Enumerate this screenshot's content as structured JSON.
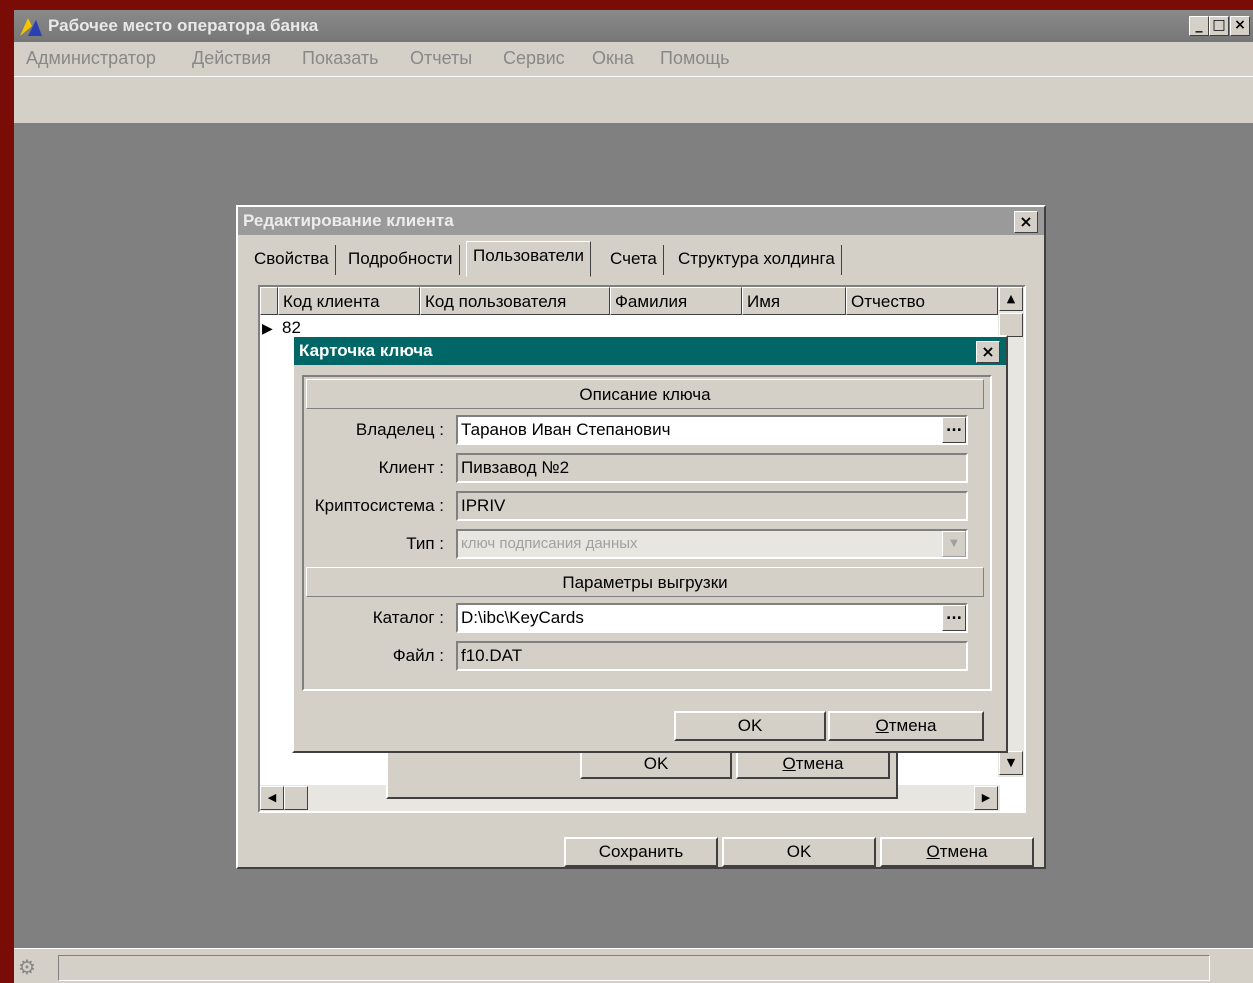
{
  "app": {
    "title": "Рабочее место оператора банка",
    "window_buttons": [
      "_",
      "□",
      "×"
    ],
    "menu": [
      "Администратор",
      "Действия",
      "Показать",
      "Отчеты",
      "Сервис",
      "Окна",
      "Помощь"
    ]
  },
  "edit_dialog": {
    "title": "Редактирование клиента",
    "close": "×",
    "tabs": [
      "Свойства",
      "Подробности",
      "Пользователи",
      "Счета",
      "Структура холдинга"
    ],
    "active_tab": "Пользователи",
    "grid": {
      "columns": [
        "Код клиента",
        "Код пользователя",
        "Фамилия",
        "Имя",
        "Отчество"
      ],
      "first_row_visible": "82"
    },
    "buttons": {
      "save": "Сохранить",
      "ok": "OK",
      "cancel_prefix": "О",
      "cancel_rest": "тмена"
    }
  },
  "middle_dialog": {
    "buttons": {
      "ok": "OK",
      "cancel_prefix": "О",
      "cancel_rest": "тмена"
    }
  },
  "key_card": {
    "title": "Карточка ключа",
    "close": "×",
    "section_description": "Описание ключа",
    "owner_label": "Владелец :",
    "owner_value": "Таранов Иван Степанович",
    "client_label": "Клиент :",
    "client_value": "Пивзавод №2",
    "crypto_label": "Криптосистема :",
    "crypto_value": "IPRIV",
    "type_label": "Тип :",
    "type_value": "ключ подписания данных",
    "section_export": "Параметры выгрузки",
    "catalog_label": "Каталог :",
    "catalog_value": "D:\\ibc\\KeyCards",
    "file_label": "Файл :",
    "file_value": "f10.DAT",
    "buttons": {
      "ok": "OK",
      "cancel_prefix": "О",
      "cancel_rest": "тмена"
    },
    "ellipsis": "..."
  },
  "colors": {
    "key_title_bar": "#006666",
    "desktop": "#808080",
    "face": "#d4d0c8",
    "frame": "#7a0c08"
  }
}
